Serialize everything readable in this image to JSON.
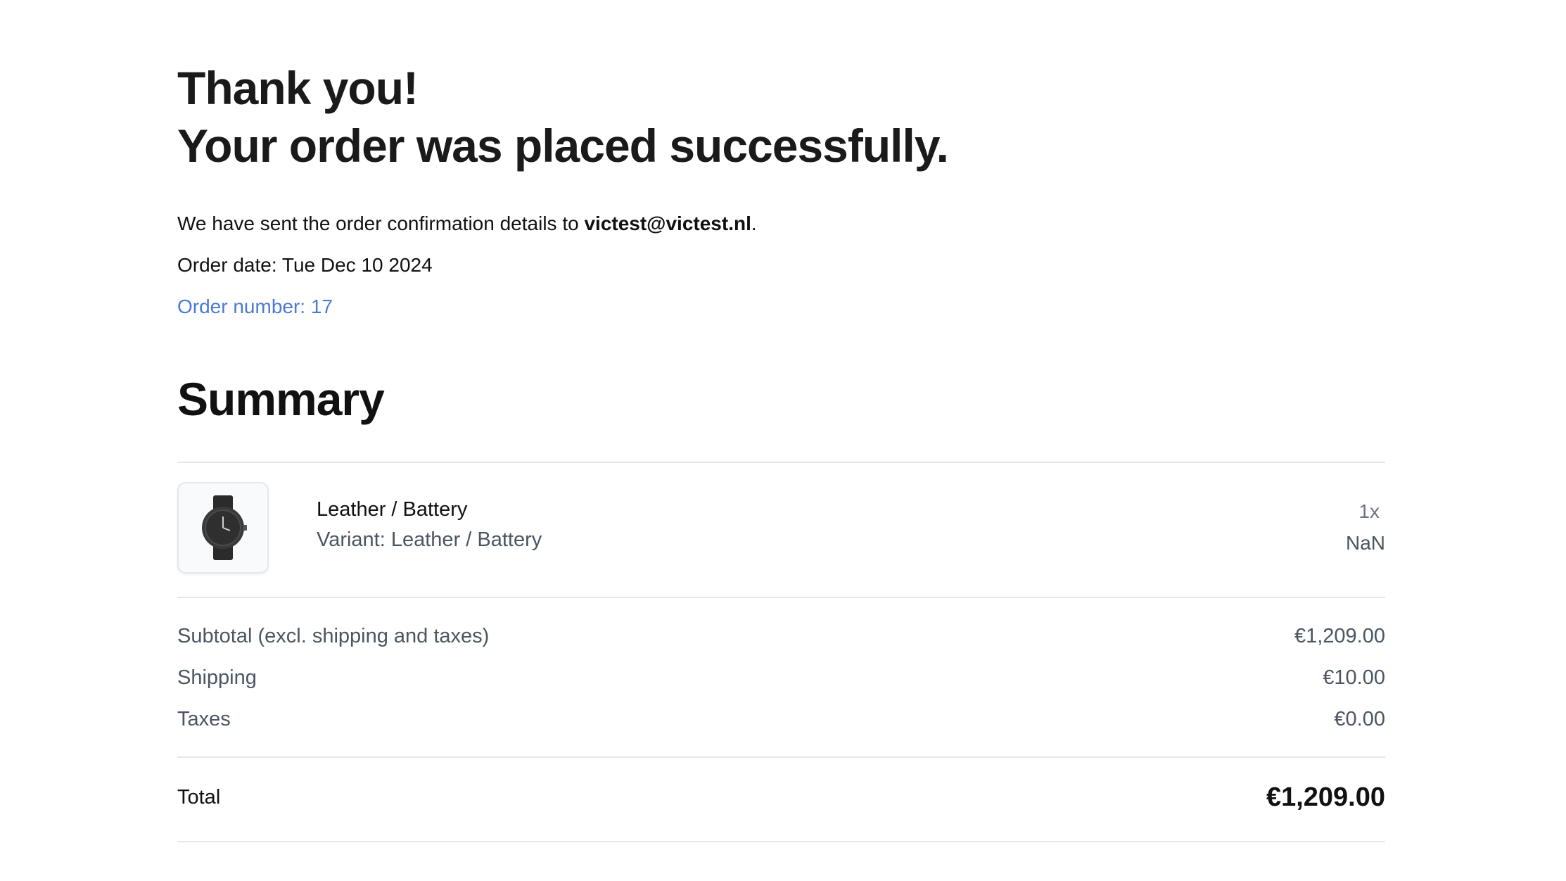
{
  "header": {
    "line1": "Thank you!",
    "line2": "Your order was placed successfully."
  },
  "confirmation": {
    "prefix": "We have sent the order confirmation details to ",
    "email": "victest@victest.nl",
    "suffix": "."
  },
  "order": {
    "date": "Order date: Tue Dec 10 2024",
    "number": "Order number: 17"
  },
  "summary": {
    "title": "Summary",
    "items": [
      {
        "image": "watch-product-image",
        "title": "Leather / Battery",
        "variant": "Variant: Leather / Battery",
        "quantity": "1x",
        "price": "NaN"
      }
    ],
    "subtotal_label": "Subtotal (excl. shipping and taxes)",
    "subtotal_value": "€1,209.00",
    "shipping_label": "Shipping",
    "shipping_value": "€10.00",
    "taxes_label": "Taxes",
    "taxes_value": "€0.00",
    "total_label": "Total",
    "total_value": "€1,209.00"
  },
  "colors": {
    "link": "#4a7ad6",
    "divider": "#e5e7eb",
    "text_muted": "#4b5563"
  }
}
